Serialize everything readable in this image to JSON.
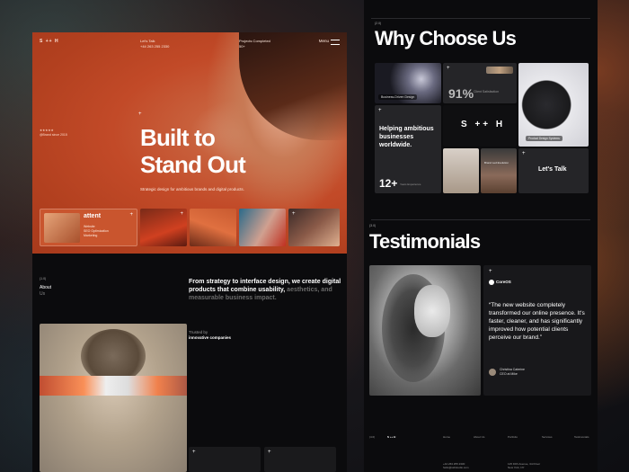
{
  "left": {
    "logo": "S ++ H",
    "talk": {
      "label": "Let's Talk",
      "phone": "+44 263 255 2330"
    },
    "projects": {
      "label": "Projects Completed",
      "value": "50+"
    },
    "menu": "Menu",
    "rating": {
      "stars": "★★★★★",
      "text": "@Brand since 2015"
    },
    "hero_title_1": "Built to",
    "hero_title_2": "Stand Out",
    "hero_subtitle": "Strategic design for ambitious brands and digital products.",
    "attent": {
      "name": "attent",
      "tags": [
        "Website",
        "SEO Optimization",
        "Marketing"
      ]
    },
    "about_label": "(1.0)",
    "about_title": "About",
    "about_sub": "Us",
    "statement_main": "From strategy to interface design, we create digital products that combine usability,",
    "statement_dim": "aesthetics, and measurable business impact.",
    "trusted_label": "Trusted by",
    "trusted_value": "innovative companies"
  },
  "right": {
    "why_label": "(2.0)",
    "why_title": "Why Choose Us",
    "tiles": {
      "tag_a": "Business-Driven Design",
      "stat_num": "91%",
      "stat_label": "Client Satisfaction",
      "tag_c": "Product Design Systems",
      "headline": "Helping ambitious businesses worldwide.",
      "years_num": "12+",
      "years_label": "Years Experience",
      "logo": "S ++ H",
      "tag_g": "Brand Led Evolution",
      "lets_talk": "Let's Talk"
    },
    "test_label": "(3.0)",
    "test_title": "Testimonials",
    "quote": {
      "brand": "CoreOS",
      "text": "“The new website completely transformed our online presence. It's faster, cleaner, and has significantly improved how potential clients perceive our brand.”",
      "author": "Christina Caterine",
      "role": "CEO at Mike"
    },
    "footer": {
      "label": "(4.0)",
      "logo": "S ++ H",
      "nav": [
        "Home",
        "About Us",
        "Portfolio",
        "Services",
        "Testimonials"
      ],
      "phone": "+44 263 255 2330",
      "email": "hello@sshstudio.com",
      "address_1": "125 Fifth Avenue, 3rd Floor",
      "address_2": "New York, NY"
    }
  }
}
